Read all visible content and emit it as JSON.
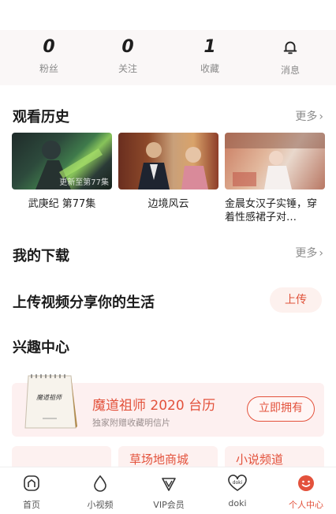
{
  "stats": [
    {
      "value": "0",
      "label": "粉丝"
    },
    {
      "value": "0",
      "label": "关注"
    },
    {
      "value": "1",
      "label": "收藏"
    },
    {
      "label": "消息",
      "icon": "bell-icon"
    }
  ],
  "history": {
    "title": "观看历史",
    "more": "更多",
    "items": [
      {
        "title": "武庚纪 第77集",
        "caption": "更新至第77集"
      },
      {
        "title": "边境风云"
      },
      {
        "title": "金晨女汉子实锤，穿着性感裙子对…"
      }
    ]
  },
  "downloads": {
    "title": "我的下载",
    "more": "更多"
  },
  "upload": {
    "title": "上传视频分享你的生活",
    "button": "上传"
  },
  "interest": {
    "title": "兴趣中心",
    "promo": {
      "title": "魔道祖师 2020 台历",
      "subtitle": "独家附赠收藏明信片",
      "button": "立即拥有",
      "calendar_text": "魔道祖师"
    },
    "cards": [
      "草场地商城",
      "小说频道"
    ]
  },
  "tabbar": [
    {
      "label": "首页",
      "icon": "home-icon"
    },
    {
      "label": "小视频",
      "icon": "drop-icon"
    },
    {
      "label": "VIP会员",
      "icon": "vip-diamond-icon"
    },
    {
      "label": "doki",
      "icon": "doki-heart-icon"
    },
    {
      "label": "个人中心",
      "icon": "smile-face-icon",
      "active": true
    }
  ],
  "colors": {
    "accent": "#e3523c",
    "promo_bg": "#fdf0f0",
    "stats_bg": "#faf7f7"
  }
}
